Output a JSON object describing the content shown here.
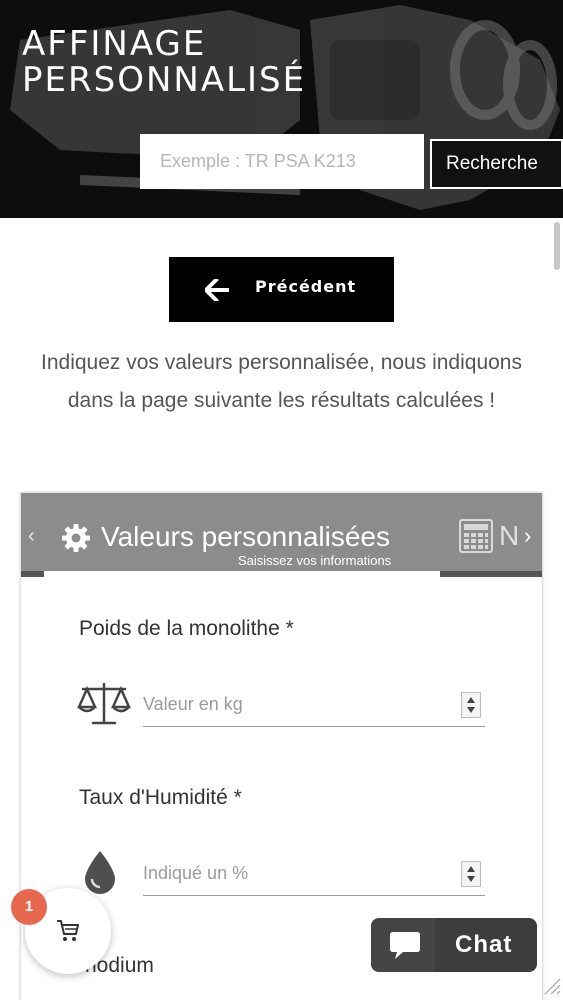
{
  "header": {
    "title_line1": "AFFINAGE",
    "title_line2": "PERSONNALISÉ",
    "search_placeholder": "Exemple : TR PSA K213",
    "search_button": "Recherche"
  },
  "nav": {
    "previous_label": "Précédent"
  },
  "intro_text": "Indiquez vos valeurs personnalisée, nous indiquons dans la page suivante les résultats calculées !",
  "wizard": {
    "active_tab_title": "Valeurs personnalisées",
    "active_tab_subtitle": "Saisissez vos informations",
    "next_tab_partial": "N",
    "fields": [
      {
        "label": "Poids de la monolithe *",
        "placeholder": "Valeur en kg",
        "icon": "scale-icon"
      },
      {
        "label": "Taux d'Humidité *",
        "placeholder": "Indiqué un %",
        "icon": "water-drop-icon"
      },
      {
        "label": "hodium",
        "icon": ""
      }
    ]
  },
  "cart": {
    "count": "1",
    "icon": "shopping-cart-icon"
  },
  "chat": {
    "label": "Chat",
    "icon": "chat-bubble-icon"
  },
  "colors": {
    "header_bg": "#0d0d0d",
    "wizard_header_bg": "#8c8c8c",
    "badge": "#e8684f",
    "chat_bg": "#3d3d3d"
  }
}
